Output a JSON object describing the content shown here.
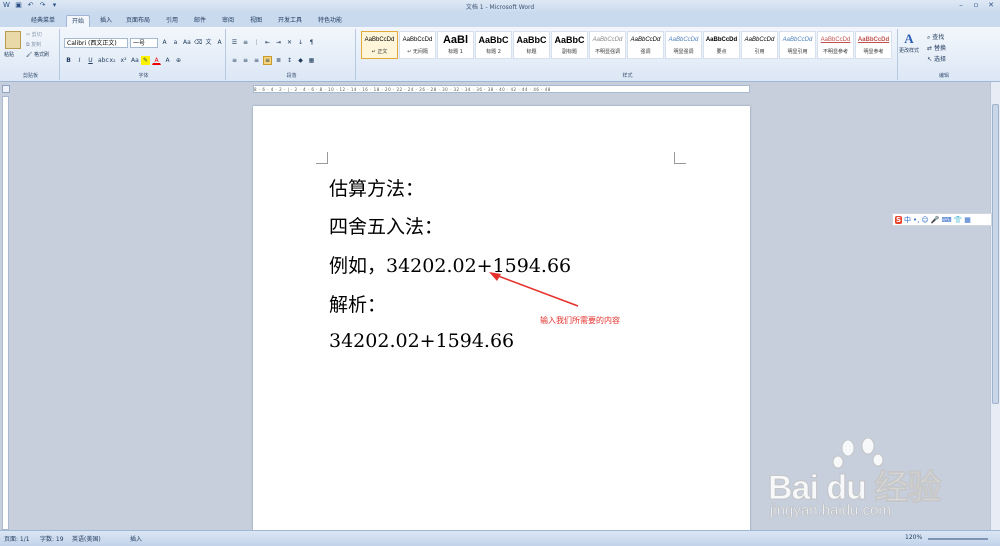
{
  "window": {
    "title": "文档 1 - Microsoft Word"
  },
  "tabs": [
    "经典菜单",
    "开始",
    "插入",
    "页面布局",
    "引用",
    "邮件",
    "审阅",
    "视图",
    "开发工具",
    "特色功能"
  ],
  "clipboard": {
    "paste": "粘贴",
    "cut": "剪切",
    "copy": "复制",
    "format_painter": "格式刷",
    "label": "剪贴板"
  },
  "font": {
    "name": "Calibri (西文正文)",
    "size": "一号",
    "label": "字体"
  },
  "paragraph": {
    "label": "段落"
  },
  "styles": {
    "label": "样式",
    "items": [
      {
        "preview": "AaBbCcDd",
        "name": "↵ 正文"
      },
      {
        "preview": "AaBbCcDd",
        "name": "↵ 无间隔"
      },
      {
        "preview": "AaBl",
        "name": "标题 1"
      },
      {
        "preview": "AaBbC",
        "name": "标题 2"
      },
      {
        "preview": "AaBbC",
        "name": "标题"
      },
      {
        "preview": "AaBbC",
        "name": "副标题"
      },
      {
        "preview": "AaBbCcDd",
        "name": "不明显强调"
      },
      {
        "preview": "AaBbCcDd",
        "name": "强调"
      },
      {
        "preview": "AaBbCcDd",
        "name": "明显强调"
      },
      {
        "preview": "AaBbCcDd",
        "name": "要点"
      },
      {
        "preview": "AaBbCcDd",
        "name": "引用"
      },
      {
        "preview": "AaBbCcDd",
        "name": "明显引用"
      },
      {
        "preview": "AaBbCcDd",
        "name": "不明显参考"
      },
      {
        "preview": "AaBbCcDd",
        "name": "明显参考"
      }
    ],
    "change": "更改样式"
  },
  "editing": {
    "find": "查找",
    "replace": "替换",
    "select": "选择",
    "label": "编辑"
  },
  "ruler": {
    "marks": "8 · 6 · 4 · 2 · | · 2 · 4 · 6 · 8 · 10 · 12 · 14 · 16 · 18 · 20 · 22 · 24 · 26 · 28 · 30 · 32 · 34 · 36 · 38 · 40 · 42 · 44 · 46 · 48"
  },
  "document": {
    "lines": [
      "估算方法：",
      "四舍五入法：",
      "例如，34202.02+1594.66",
      "解析：",
      "34202.02+1594.66"
    ]
  },
  "annotation": {
    "text": "输入我们所需要的内容",
    "color": "#e5312c"
  },
  "ime": {
    "logo": "S",
    "mode": "中"
  },
  "status": {
    "page": "页面: 1/1",
    "words": "字数: 19",
    "lang": "英语(美国)",
    "insert": "插入",
    "zoom": "120%"
  },
  "watermark": {
    "brand": "Bai du 经验",
    "sub": "jingyan.baidu.com"
  }
}
